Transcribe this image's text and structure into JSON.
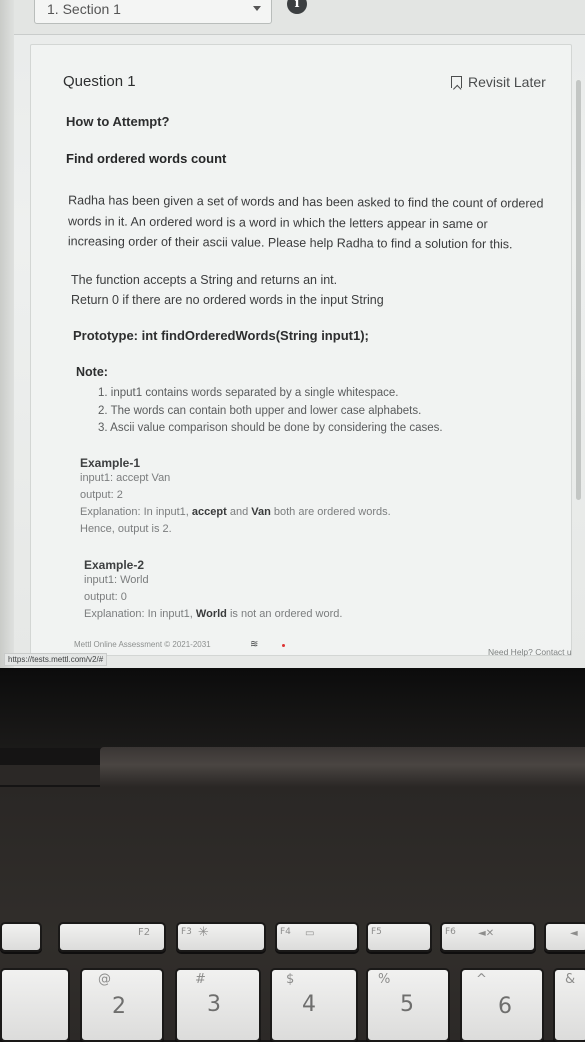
{
  "topbar": {
    "section_label": "1. Section 1",
    "info_glyph": "i"
  },
  "question": {
    "title": "Question 1",
    "revisit_label": "Revisit Later",
    "how_to_attempt": "How to Attempt?",
    "problem_title": "Find ordered words count",
    "description": [
      "Radha has been given a set of words and has been asked to find the count of ordered",
      "words in it.  An ordered word is a word in which the letters appear in same or",
      "increasing order of their ascii value. Please help Radha to find a solution for this."
    ],
    "function_lines": [
      "The function accepts a String and returns an int.",
      "Return 0 if there are no ordered words in the input String"
    ],
    "prototype": "Prototype: int findOrderedWords(String input1);",
    "note_label": "Note:",
    "notes": [
      "1. input1 contains words separated by a single whitespace.",
      "2. The words can contain both upper and lower case alphabets.",
      "3.  Ascii value comparison should be done by considering the cases."
    ],
    "example1": {
      "title": "Example-1",
      "input": "input1: accept Van",
      "output": "output: 2",
      "explanation_prefix": "Explanation: In input1, ",
      "word1": "accept",
      "and": " and ",
      "word2": "Van",
      "explanation_suffix": " both are ordered words.",
      "hence": "Hence, output is 2."
    },
    "example2": {
      "title": "Example-2",
      "input": "input1: World",
      "output": "output: 0",
      "explanation_prefix": "Explanation: In input1, ",
      "word": "World",
      "explanation_suffix": " is not an ordered word."
    }
  },
  "footer": {
    "copyright": "Mettl Online Assessment © 2021-2031",
    "url": "https://tests.mettl.com/v2/#",
    "help": "Need Help? Contact u"
  },
  "keyboard": {
    "fkeys": [
      "F2",
      "F3",
      "F4",
      "F5",
      "F6"
    ],
    "keys": [
      {
        "sym": "@",
        "num": "2"
      },
      {
        "sym": "#",
        "num": "3"
      },
      {
        "sym": "$",
        "num": "4"
      },
      {
        "sym": "%",
        "num": "5"
      },
      {
        "sym": "^",
        "num": "6"
      },
      {
        "sym": "&",
        "num": ""
      }
    ]
  }
}
